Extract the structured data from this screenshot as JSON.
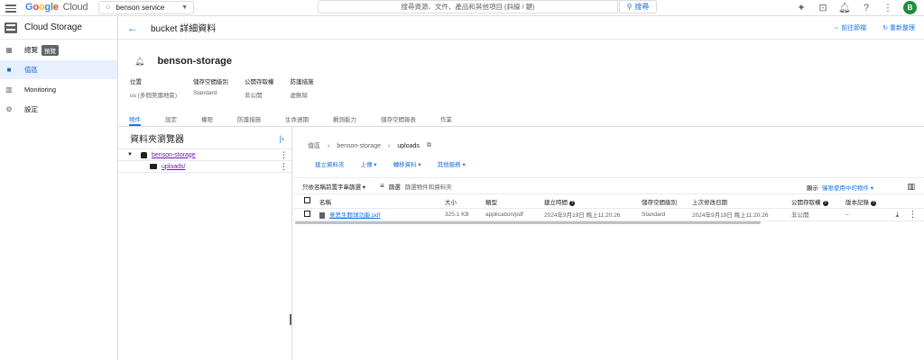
{
  "topbar": {
    "logo_text": "Google",
    "logo_sub": "Cloud",
    "project": "benson service",
    "search_placeholder": "搜尋資源、文件、產品和其他項目 (斜線 / 鍵)",
    "search_button": "搜尋",
    "avatar_letter": "B"
  },
  "nav": {
    "title": "Cloud Storage",
    "items": [
      {
        "label": "總覽",
        "badge": "預覽"
      },
      {
        "label": "值區"
      },
      {
        "label": "Monitoring"
      },
      {
        "label": "設定"
      }
    ]
  },
  "header": {
    "title": "bucket 詳細資料",
    "link_go": "前往節檔",
    "link_refresh": "重新整理"
  },
  "bucket": {
    "name": "benson-storage",
    "meta": [
      {
        "k": "位置",
        "v": "us (多個美國地區)"
      },
      {
        "k": "儲存空間級別",
        "v": "Standard"
      },
      {
        "k": "公開存取權",
        "v": "非公開"
      },
      {
        "k": "防護措施",
        "v": "虛刪除"
      }
    ]
  },
  "tabs": [
    "物件",
    "設定",
    "權限",
    "防護措施",
    "生命週期",
    "觀測能力",
    "儲存空間報表",
    "作業"
  ],
  "browser": {
    "title": "資料夾瀏覽器",
    "bucket": "benson-storage",
    "folder": "uploads/"
  },
  "content": {
    "crumb": [
      "值區",
      "benson-storage",
      "uploads"
    ],
    "actions": [
      "建立資料夾",
      "上傳",
      "轉移資料",
      "其他服務"
    ],
    "filter_select": "只依名稱前置字串篩選",
    "filter_label": "篩選",
    "filter_placeholder": "篩選物件和資料夾",
    "show_label": "顯示",
    "show_option": "僅限使用中的物件",
    "columns": [
      "名稱",
      "大小",
      "類型",
      "建立時間",
      "儲存空間級別",
      "上次修改日期",
      "公開存取權",
      "版本記錄"
    ],
    "rows": [
      {
        "name": "意思生聽球功能.pdf",
        "size": "325.1 KB",
        "type": "application/pdf",
        "created": "2024年9月19日 晚上11:20:26",
        "class": "Standard",
        "modified": "2024年9月19日 晚上11:20:26",
        "public": "非公開",
        "version": "–"
      }
    ]
  }
}
